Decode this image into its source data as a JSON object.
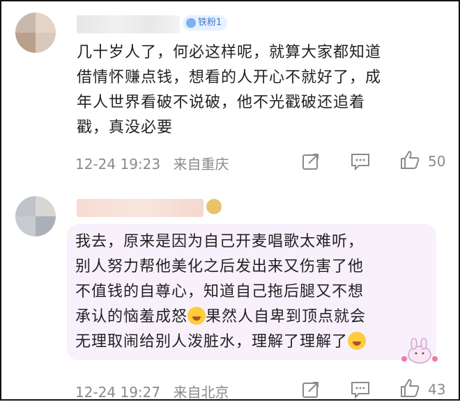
{
  "comments": [
    {
      "badge": "铁粉1",
      "text_lines": [
        "几十岁人了，何必这样呢，就算大家都知道",
        "借情怀赚点钱，想看的人开心不就好了，成",
        "年人世界看破不说破，他不光戳破还追着",
        "戳，真没必要"
      ],
      "date": "12-24 19:23",
      "location": "来自重庆",
      "likes": "50"
    },
    {
      "text_lines": [
        "我去，原来是因为自己开麦唱歌太难听，",
        "别人努力帮他美化之后发出来又伤害了他",
        "不值钱的自尊心，知道自己拖后腿又不想",
        "承认的恼羞成怒",
        "果然人自卑到顶点就会",
        "无理取闹给别人泼脏水，理解了理解了"
      ],
      "date": "12-24 19:27",
      "location": "来自北京",
      "likes": "43"
    }
  ],
  "icons": {
    "share": "share-icon",
    "comment": "comment-icon",
    "like": "thumbs-up-icon",
    "emoji": "laughing-crying-emoji-icon",
    "badge": "fan-badge-icon"
  },
  "colors": {
    "text": "#222222",
    "meta": "#8a8a8a",
    "badge_bg": "#e8f1ff",
    "badge_text": "#3a79d6",
    "bubble_bg": "#f8f1fb"
  }
}
